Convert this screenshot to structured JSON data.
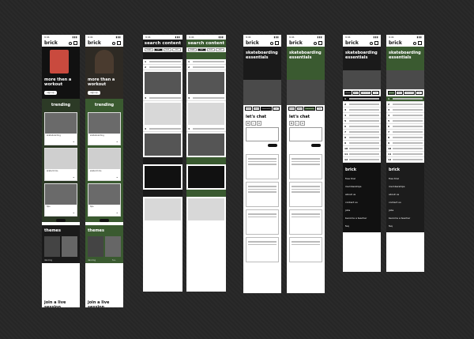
{
  "brand": "brick",
  "status": {
    "time": "9:41"
  },
  "home": {
    "hero_title_1": "more then a workout",
    "hero_title_2": "more than a workout",
    "hero_button": "sign up",
    "trending_title": "trending",
    "card_texts": [
      "skateboarding",
      "skate tricks",
      "tips"
    ],
    "themes_title": "themes",
    "theme_labels": [
      "dancing",
      "h.u."
    ],
    "live_title": "join a live session"
  },
  "search": {
    "title": "search content",
    "chips": [
      "length",
      "type",
      "level",
      "sort"
    ],
    "rows": [
      "1",
      "2",
      "3",
      "4"
    ]
  },
  "skate": {
    "title": "skateboarding essentials",
    "tabs": [
      "classes",
      "about",
      "community",
      "live"
    ],
    "chat_title": "let's chat",
    "format": [
      "B",
      "I",
      "U"
    ]
  },
  "course": {
    "rows": [
      "1",
      "2",
      "3",
      "4",
      "5",
      "6",
      "7",
      "8",
      "9",
      "10",
      "11",
      "12"
    ]
  },
  "footer": {
    "links": [
      "free trial",
      "memberships",
      "about us",
      "contact us",
      "jobs",
      "become a teacher",
      "faq"
    ]
  }
}
